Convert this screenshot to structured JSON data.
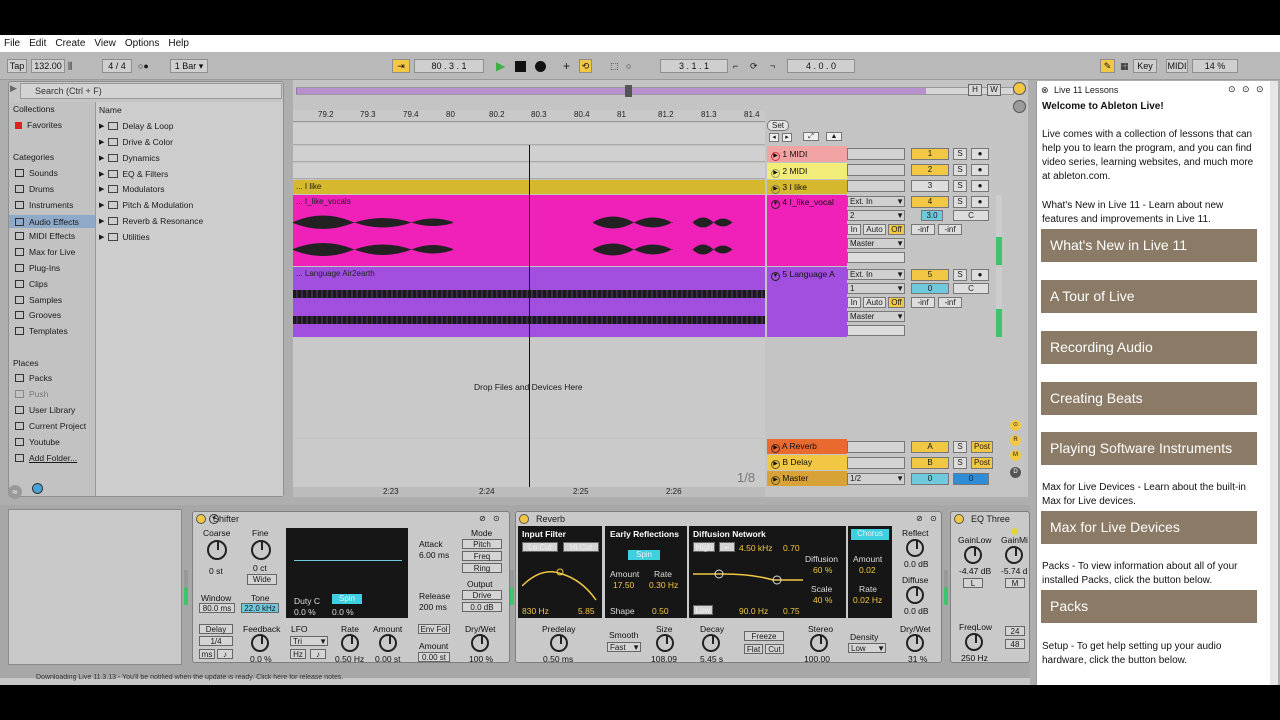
{
  "menu": [
    "File",
    "Edit",
    "Create",
    "View",
    "Options",
    "Help"
  ],
  "transport": {
    "tap": "Tap",
    "tempo": "132.00",
    "sig": "4 / 4",
    "quant": "1 Bar",
    "pos": "80 .  3 .  1",
    "loop_start": "3 .  1 .  1",
    "loop_len": "4 .  0 .  0",
    "key": "Key",
    "midi": "MIDI",
    "cpu": "14 %"
  },
  "browser": {
    "search": "Search (Ctrl + F)",
    "collections_title": "Collections",
    "favorites": "Favorites",
    "categories_title": "Categories",
    "categories": [
      "Sounds",
      "Drums",
      "Instruments",
      "Audio Effects",
      "MIDI Effects",
      "Max for Live",
      "Plug-Ins",
      "Clips",
      "Samples",
      "Grooves",
      "Templates"
    ],
    "places_title": "Places",
    "places": [
      "Packs",
      "Push",
      "User Library",
      "Current Project",
      "Youtube",
      "Add Folder..."
    ],
    "name_header": "Name",
    "folders": [
      "Delay & Loop",
      "Drive & Color",
      "Dynamics",
      "EQ & Filters",
      "Modulators",
      "Pitch & Modulation",
      "Reverb & Resonance",
      "Utilities"
    ]
  },
  "ruler": [
    "79.2",
    "79.3",
    "79.4",
    "80",
    "80.2",
    "80.3",
    "80.4",
    "81",
    "81.2",
    "81.3",
    "81.4"
  ],
  "timeline": [
    "2:23",
    "2:24",
    "2:25",
    "2:26"
  ],
  "set_label": "Set",
  "drop_text": "Drop Files and Devices Here",
  "page_counter": "1/8",
  "tracks": [
    {
      "name": "1 MIDI",
      "num": "1"
    },
    {
      "name": "2 MIDI",
      "num": "2"
    },
    {
      "name": "3 I like",
      "num": "3",
      "clip": "... I like"
    },
    {
      "name": "4 I_like_vocal",
      "num": "4",
      "clip": "... I_like_vocals",
      "input": "Ext. In",
      "chan": "2",
      "vol": "3.0",
      "pan": "C",
      "out": "Master",
      "in_btn": "In",
      "auto_btn": "Auto",
      "off_btn": "Off",
      "inf1": "-inf",
      "inf2": "-inf"
    },
    {
      "name": "5 Language A",
      "num": "5",
      "clip": "... Language Air2earth",
      "input": "Ext. In",
      "chan": "1",
      "vol": "0",
      "pan": "C",
      "out": "Master",
      "in_btn": "In",
      "auto_btn": "Auto",
      "off_btn": "Off",
      "inf1": "-inf",
      "inf2": "-inf"
    }
  ],
  "returns": [
    {
      "name": "A Reverb",
      "num": "A",
      "post": "Post"
    },
    {
      "name": "B Delay",
      "num": "B",
      "post": "Post"
    },
    {
      "name": "Master",
      "num": "0",
      "sel": "1/2",
      "vol": "0"
    }
  ],
  "lessons": {
    "title": "Live 11 Lessons",
    "welcome": "Welcome to Ableton Live!",
    "intro": "Live comes with a collection of lessons that can help you to learn the program, and you can find video series, learning websites, and much more at ableton.com.",
    "whatsnew_text": "What's New in Live 11 - Learn about new features and improvements in Live 11.",
    "buttons": [
      "What's New in Live 11",
      "A Tour of Live",
      "Recording Audio",
      "Creating Beats",
      "Playing Software Instruments"
    ],
    "maxtext": "Max for Live Devices - Learn about the built-in Max for Live devices.",
    "max_button": "Max for Live Devices",
    "packstext": "Packs - To view information about all of your installed Packs, click the button below.",
    "packs_button": "Packs",
    "setuptext": "Setup - To get help setting up your audio hardware, click the button below."
  },
  "shifter": {
    "title": "Shifter",
    "coarse": "Coarse",
    "coarse_v": "0 st",
    "fine": "Fine",
    "fine_v": "0 ct",
    "wide": "Wide",
    "window": "Window",
    "window_v": "80.0 ms",
    "tone": "Tone",
    "tone_v": "22.0 kHz",
    "duty": "Duty C",
    "duty_v": "0.0 %",
    "spin": "Spin",
    "spin_v": "0.0 %",
    "attack": "Attack",
    "attack_v": "6.00 ms",
    "release": "Release",
    "release_v": "200 ms",
    "mode": "Mode",
    "modes": [
      "Pitch",
      "Freq",
      "Ring"
    ],
    "output": "Output",
    "drive": "Drive",
    "drive_v": "0.0 dB",
    "delay": "Delay",
    "delay_v": "1/4",
    "ms": "ms",
    "feedback": "Feedback",
    "feedback_v": "0.0 %",
    "lfo": "LFO",
    "lfo_wave": "Tri",
    "hz": "Hz",
    "rate": "Rate",
    "rate_v": "0.50 Hz",
    "amount": "Amount",
    "amount_v": "0.00 st",
    "envfol": "Env Fol",
    "amount2": "Amount",
    "amount2_v": "0.00 st",
    "drywet": "Dry/Wet",
    "drywet_v": "100 %"
  },
  "reverb": {
    "title": "Reverb",
    "input_filter": "Input Filter",
    "locut": "Lo Cut",
    "hicut": "Hi Cut",
    "freq1": "830 Hz",
    "freq2": "5.85",
    "early": "Early Reflections",
    "spin": "Spin",
    "amount": "Amount",
    "amount_v": "17.50",
    "rate": "Rate",
    "rate_v": "0.30 Hz",
    "shape": "Shape",
    "shape_v": "0.50",
    "diffusion_net": "Diffusion Network",
    "high": "High",
    "hfreq": "4.50 kHz",
    "hval": "0.70",
    "diffusion": "Diffusion",
    "diffusion_v": "60 %",
    "scale": "Scale",
    "scale_v": "40 %",
    "low": "Low",
    "lfreq": "90.0 Hz",
    "lval": "0.75",
    "chorus": "Chorus",
    "c_amount": "Amount",
    "c_amount_v": "0.02",
    "c_rate": "Rate",
    "c_rate_v": "0.02 Hz",
    "reflect": "Reflect",
    "reflect_v": "0.0 dB",
    "diffuse": "Diffuse",
    "diffuse_v": "0.0 dB",
    "predelay": "Predelay",
    "predelay_v": "0.50 ms",
    "smooth": "Smooth",
    "smooth_v": "Fast",
    "size": "Size",
    "size_v": "108.09",
    "decay": "Decay",
    "decay_v": "5.45 s",
    "freeze": "Freeze",
    "flat": "Flat",
    "cut": "Cut",
    "stereo": "Stereo",
    "stereo_v": "100.00",
    "density": "Density",
    "density_v": "Low",
    "drywet": "Dry/Wet",
    "drywet_v": "31 %"
  },
  "eq": {
    "title": "EQ Three",
    "gainlow": "GainLow",
    "gainlow_v": "-4.47 dB",
    "gainmid": "GainMi",
    "gainmid_v": "-5.74 d",
    "l": "L",
    "m": "M",
    "freqlow": "FreqLow",
    "freqlow_v": "250 Hz",
    "n24": "24",
    "n48": "48"
  },
  "status": "Downloading Live 11.3.13 - You'll be notified when the update is ready. Click here for release notes."
}
